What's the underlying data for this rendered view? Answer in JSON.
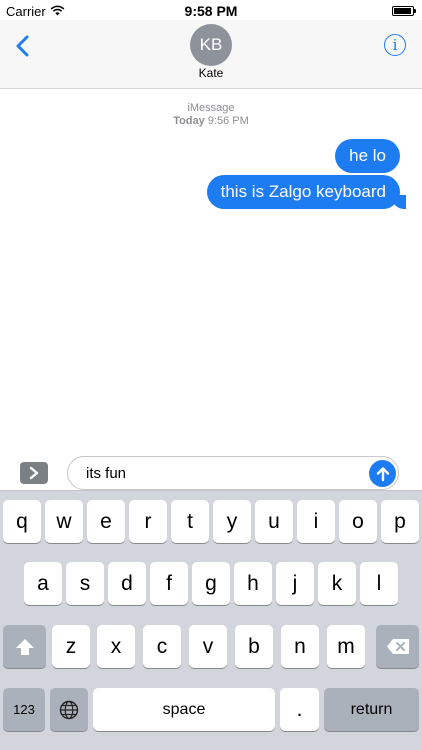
{
  "status_bar": {
    "carrier": "Carrier",
    "time": "9:58 PM",
    "battery_level": 0.95
  },
  "header": {
    "avatar_initials": "KB",
    "contact_name": "Kate"
  },
  "conversation": {
    "service": "iMessage",
    "day": "Today",
    "time": "9:56 PM",
    "messages": [
      {
        "text": "he lo",
        "from": "me"
      },
      {
        "text": "this is Zalgo keyboard",
        "from": "me"
      }
    ]
  },
  "input": {
    "value": "its fun"
  },
  "keyboard": {
    "row1": [
      "q",
      "w",
      "e",
      "r",
      "t",
      "y",
      "u",
      "i",
      "o",
      "p"
    ],
    "row2": [
      "a",
      "s",
      "d",
      "f",
      "g",
      "h",
      "j",
      "k",
      "l"
    ],
    "row3": [
      "z",
      "x",
      "c",
      "v",
      "b",
      "n",
      "m"
    ],
    "numbers_label": "123",
    "space_label": "space",
    "period_label": ".",
    "return_label": "return"
  },
  "colors": {
    "accent": "#1e7cf2",
    "bubble_text": "#ffffff",
    "keyboard_bg": "#d2d5db",
    "dark_key": "#abb1bb"
  },
  "icons": {
    "back": "chevron-left-icon",
    "info": "info-icon",
    "apps": "chevron-right-icon",
    "send": "arrow-up-icon",
    "shift": "shift-icon",
    "delete": "delete-icon",
    "globe": "globe-icon",
    "wifi": "wifi-icon",
    "battery": "battery-icon"
  }
}
